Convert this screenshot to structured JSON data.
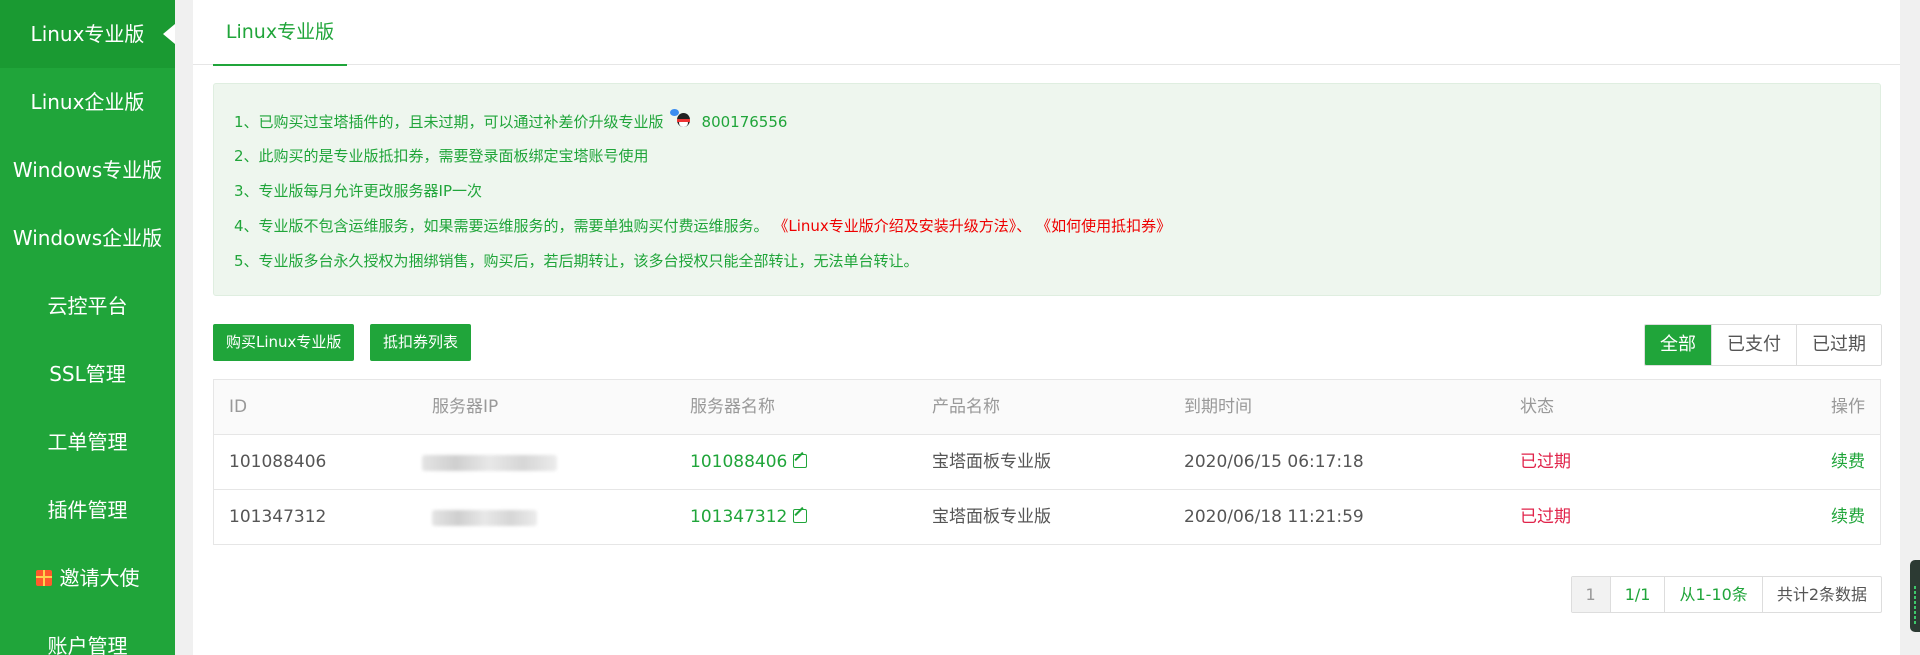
{
  "sidebar": {
    "items": [
      {
        "label": "Linux专业版",
        "active": true
      },
      {
        "label": "Linux企业版"
      },
      {
        "label": "Windows专业版"
      },
      {
        "label": "Windows企业版"
      },
      {
        "label": "云控平台"
      },
      {
        "label": "SSL管理"
      },
      {
        "label": "工单管理"
      },
      {
        "label": "插件管理"
      },
      {
        "label": "邀请大使",
        "icon": "gift-icon"
      },
      {
        "label": "账户管理"
      }
    ]
  },
  "tabs": [
    {
      "label": "Linux专业版"
    }
  ],
  "notice": {
    "line1": "1、已购买过宝塔插件的，且未过期，可以通过补差价升级专业版",
    "qq_number": "800176556",
    "line2": "2、此购买的是专业版抵扣券，需要登录面板绑定宝塔账号使用",
    "line3": "3、专业版每月允许更改服务器IP一次",
    "line4": "4、专业版不包含运维服务，如果需要运维服务的，需要单独购买付费运维服务。",
    "link_intro": "《Linux专业版介绍及安装升级方法》",
    "link_sep": "、",
    "link_coupon": "《如何使用抵扣券》",
    "line5": "5、专业版多台永久授权为捆绑销售，购买后，若后期转让，该多台授权只能全部转让，无法单台转让。"
  },
  "actions": {
    "buy_label": "购买Linux专业版",
    "coupons_label": "抵扣券列表"
  },
  "filters": [
    {
      "label": "全部",
      "active": true
    },
    {
      "label": "已支付"
    },
    {
      "label": "已过期"
    }
  ],
  "table": {
    "headers": [
      "ID",
      "服务器IP",
      "服务器名称",
      "产品名称",
      "到期时间",
      "状态",
      "操作"
    ],
    "rows": [
      {
        "id": "101088406",
        "ip": "",
        "name": "101088406",
        "product": "宝塔面板专业版",
        "expire": "2020/06/15 06:17:18",
        "status": "已过期",
        "action": "续费"
      },
      {
        "id": "101347312",
        "ip": "",
        "name": "101347312",
        "product": "宝塔面板专业版",
        "expire": "2020/06/18 11:21:59",
        "status": "已过期",
        "action": "续费"
      }
    ]
  },
  "pagination": {
    "current": "1",
    "pages": "1/1",
    "range": "从1-10条",
    "total": "共计2条数据"
  },
  "colors": {
    "brand": "#20a53a",
    "expired": "#e0234a",
    "link_red": "#ee0000"
  }
}
